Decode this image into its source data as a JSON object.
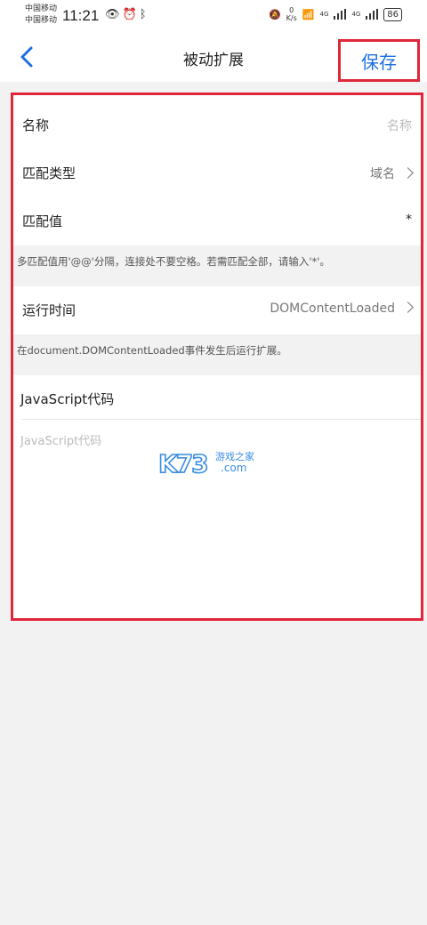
{
  "status_bar": {
    "carrier_1": "中国移动",
    "carrier_2": "中国移动",
    "time": "11:21",
    "speed_value": "0",
    "speed_unit": "K/s",
    "network_1": "4G",
    "network_2": "4G",
    "battery": "86"
  },
  "nav": {
    "title": "被动扩展",
    "save_label": "保存"
  },
  "form": {
    "name_label": "名称",
    "name_placeholder": "名称",
    "match_type_label": "匹配类型",
    "match_type_value": "域名",
    "match_value_label": "匹配值",
    "match_value_value": "*",
    "match_hint": "多匹配值用'@@'分隔，连接处不要空格。若需匹配全部，请输入'*'。",
    "run_time_label": "运行时间",
    "run_time_value": "DOMContentLoaded",
    "run_time_hint": "在document.DOMContentLoaded事件发生后运行扩展。",
    "js_label": "JavaScript代码",
    "js_placeholder": "JavaScript代码"
  },
  "watermark": {
    "logo": "K73",
    "sub": "游戏之家",
    "domain": ".com"
  },
  "colors": {
    "accent": "#1f6fe0",
    "highlight_border": "#e0263a",
    "background": "#f2f2f2"
  }
}
